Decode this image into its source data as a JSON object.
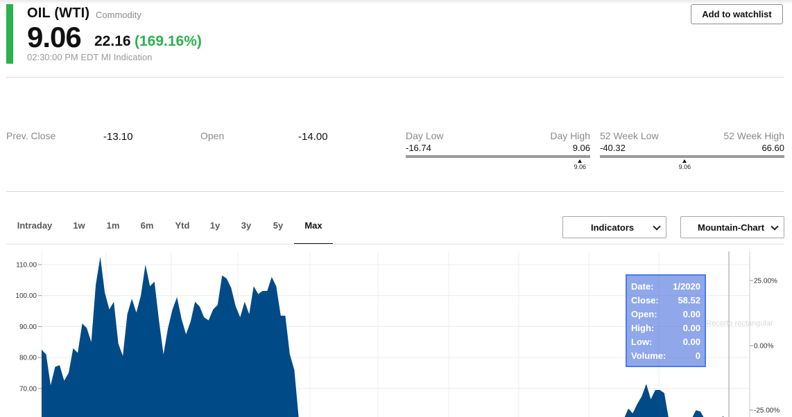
{
  "header": {
    "name": "OIL (WTI)",
    "type": "Commodity",
    "price": "9.06",
    "change": "22.16",
    "change_pct": "(169.16%)",
    "timestamp": "02:30:00 PM EDT MI Indication",
    "watchlist_label": "Add to watchlist",
    "colors": {
      "positive": "#2bb24c",
      "text": "#111111"
    }
  },
  "stats": {
    "prev_close_label": "Prev. Close",
    "prev_close": "-13.10",
    "open_label": "Open",
    "open": "-14.00",
    "day_range": {
      "low_label": "Day Low",
      "high_label": "Day High",
      "low": "-16.74",
      "high": "9.06",
      "current": "9.06",
      "position": 1.0
    },
    "week52_range": {
      "low_label": "52 Week Low",
      "high_label": "52 Week High",
      "low": "-40.32",
      "high": "66.60",
      "current": "9.06",
      "position": 0.46
    }
  },
  "chart_controls": {
    "tabs": [
      "Intraday",
      "1w",
      "1m",
      "6m",
      "Ytd",
      "1y",
      "3y",
      "5y",
      "Max"
    ],
    "active_tab": "Max",
    "indicators_label": "Indicators",
    "chart_type_label": "Mountain-Chart"
  },
  "tooltip": {
    "rows": [
      {
        "label": "Date:",
        "value": "1/2020"
      },
      {
        "label": "Close:",
        "value": "58.52"
      },
      {
        "label": "Open:",
        "value": "0.00"
      },
      {
        "label": "High:",
        "value": "0.00"
      },
      {
        "label": "Low:",
        "value": "0.00"
      },
      {
        "label": "Volume:",
        "value": "0"
      }
    ],
    "ghost_text": "Recorte rectangular"
  },
  "chart_data": {
    "type": "area",
    "color": "#004a87",
    "y_ticks": [
      "110.00",
      "100.00",
      "90.00",
      "80.00",
      "70.00"
    ],
    "y_tick_values": [
      110,
      100,
      90,
      80,
      70
    ],
    "pct_ticks": [
      "25.00%",
      "0.00%",
      "-25.00%"
    ],
    "grid": true,
    "series": [
      {
        "values": [
          82.5,
          81,
          71,
          77,
          77.5,
          72.5,
          75,
          83,
          81.5,
          91,
          89.5,
          85,
          103.5,
          112.5,
          101,
          95.5,
          98,
          84.5,
          80.5,
          94,
          99,
          94.5,
          100,
          110,
          103,
          104.5,
          92,
          81,
          89.5,
          95.5,
          99.5,
          92.5,
          87.5,
          91.5,
          98,
          96.5,
          93,
          92,
          95.5,
          97,
          106.5,
          105.5,
          102.5,
          96.5,
          93,
          98,
          94,
          103,
          100.5,
          101.5,
          101.5,
          106,
          103,
          93.5,
          93.5,
          81,
          76,
          60,
          60,
          60,
          60,
          60,
          60,
          60,
          60,
          60,
          60,
          60,
          60,
          60,
          60,
          60,
          60,
          60,
          60,
          60,
          60,
          60,
          60,
          60,
          60,
          60,
          60,
          60,
          60,
          60,
          60,
          60,
          60,
          60,
          60,
          60,
          60,
          60,
          60,
          60,
          60,
          60,
          60,
          60,
          60,
          60,
          60,
          60,
          60,
          60,
          60,
          60,
          60,
          60,
          60,
          60,
          60,
          60,
          60,
          60,
          60,
          60,
          60,
          60,
          60,
          60,
          60,
          60,
          60,
          60,
          60,
          60,
          60,
          60,
          63.5,
          62,
          65,
          67.5,
          71.5,
          66.5,
          69.5,
          69.5,
          68.5,
          60,
          60,
          60,
          60,
          60,
          60,
          63,
          62.5,
          60,
          60,
          60,
          60,
          61,
          60
        ]
      }
    ]
  }
}
